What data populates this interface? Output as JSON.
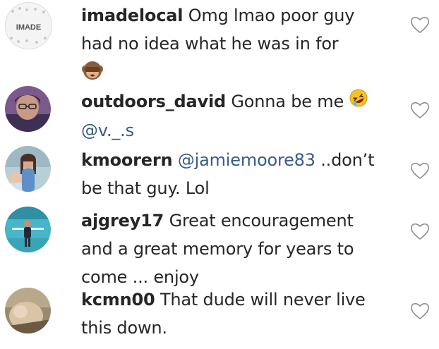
{
  "comments": [
    {
      "username": "imadelocal",
      "text_lines": [
        "Omg lmao poor guy",
        "had no idea what he was in for"
      ],
      "emoji": "see-no-evil-monkey",
      "avatar_text": "IMADE",
      "icon": "heart-outline-icon"
    },
    {
      "username": "outdoors_david",
      "text": "Gonna be me",
      "emoji": "rolling-on-floor-laughing",
      "mention": "@v._.s",
      "icon": "heart-outline-icon"
    },
    {
      "username": "kmoorern",
      "mention": "@jamiemoore83",
      "text_after_mention": "..don’t",
      "text_line2": "be that guy. Lol",
      "icon": "heart-outline-icon"
    },
    {
      "username": "ajgrey17",
      "text": "Great encouragement",
      "text_line2": "and a great memory for years to",
      "text_line3": "come ... enjoy",
      "icon": "heart-outline-icon"
    },
    {
      "username": "kcmn00",
      "text": "That dude will never live",
      "text_line2": "this down.",
      "icon": "heart-outline-icon"
    }
  ],
  "colors": {
    "text": "#262626",
    "mention": "#3b5a8c",
    "heart": "#8e8e8e"
  }
}
